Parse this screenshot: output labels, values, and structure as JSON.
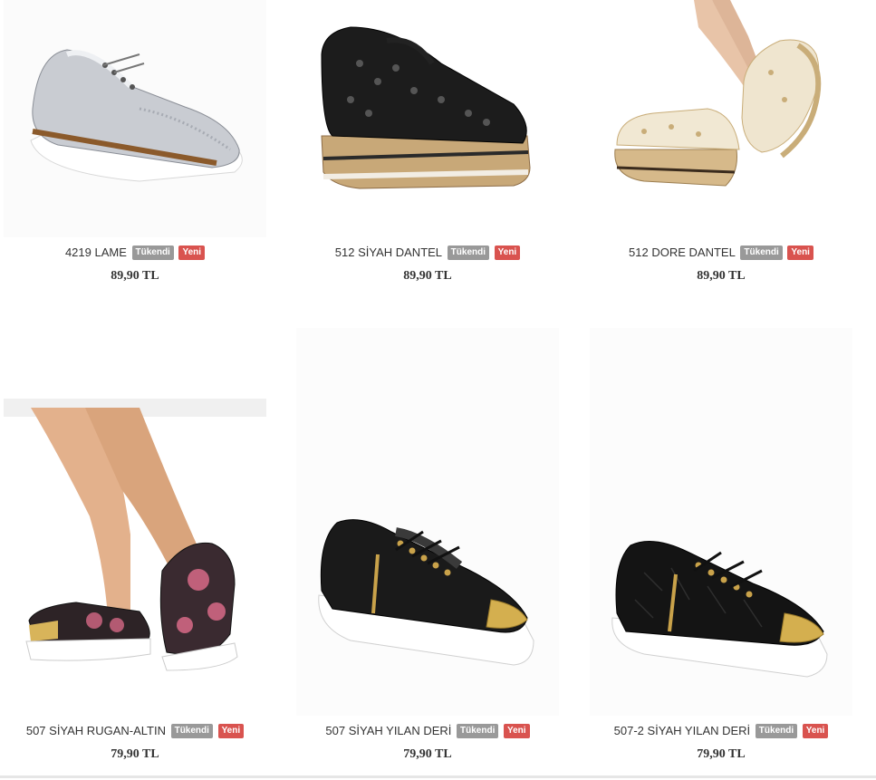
{
  "products": [
    {
      "name": "4219 LAME",
      "badge_sold_out": "Tükendi",
      "badge_new": "Yeni",
      "price": "89,90 TL",
      "image": "silver-brogue-shoe"
    },
    {
      "name": "512 SİYAH DANTEL",
      "badge_sold_out": "Tükendi",
      "badge_new": "Yeni",
      "price": "89,90 TL",
      "image": "black-lace-espadrille-shoe"
    },
    {
      "name": "512 DORE DANTEL",
      "badge_sold_out": "Tükendi",
      "badge_new": "Yeni",
      "price": "89,90 TL",
      "image": "gold-lace-espadrille-shoe"
    },
    {
      "name": "507 SİYAH RUGAN-ALTIN",
      "badge_sold_out": "Tükendi",
      "badge_new": "Yeni",
      "price": "79,90 TL",
      "image": "floral-sneaker-on-leg"
    },
    {
      "name": "507 SİYAH YILAN DERİ",
      "badge_sold_out": "Tükendi",
      "badge_new": "Yeni",
      "price": "79,90 TL",
      "image": "black-snake-sneaker"
    },
    {
      "name": "507-2 SİYAH YILAN DERİ",
      "badge_sold_out": "Tükendi",
      "badge_new": "Yeni",
      "price": "79,90 TL",
      "image": "black-croc-sneaker"
    }
  ],
  "colors": {
    "badge_sold_out": "#999999",
    "badge_new": "#d9534f",
    "text": "#333333"
  }
}
